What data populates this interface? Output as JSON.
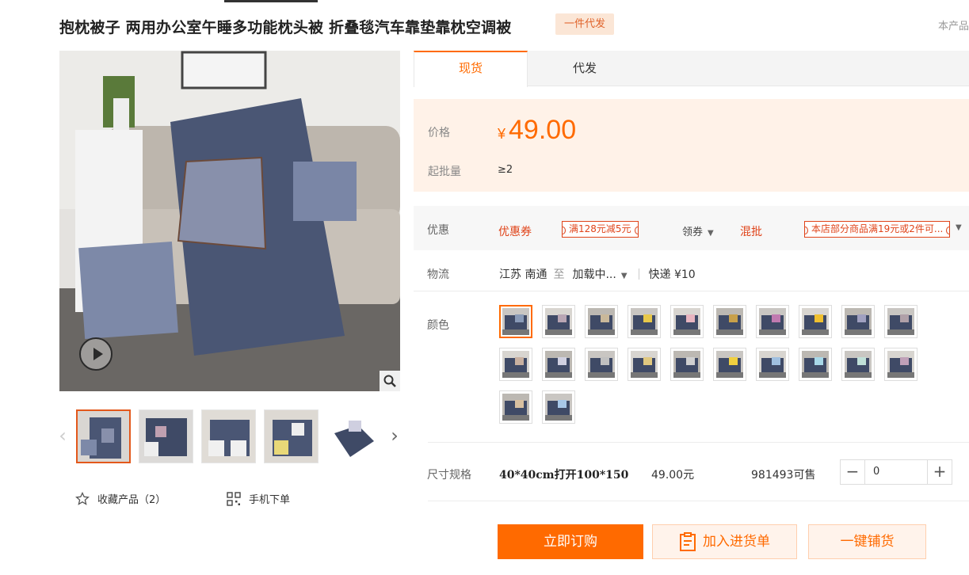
{
  "product": {
    "title": "抱枕被子 两用办公室午睡多功能枕头被 折叠毯汽车靠垫靠枕空调被",
    "tag": "一件代发",
    "corner_text": "本产品"
  },
  "gallery": {
    "thumb_count": 5,
    "favorite_label": "收藏产品（2）",
    "mobile_order_label": "手机下单",
    "play_icon": "play-icon",
    "zoom_icon": "zoom-icon"
  },
  "tabs": [
    {
      "label": "现货",
      "active": true
    },
    {
      "label": "代发",
      "active": false
    }
  ],
  "price": {
    "label": "价格",
    "currency": "¥",
    "value": "49.00",
    "moq_label": "起批量",
    "moq_value": "≥2"
  },
  "promo": {
    "label": "优惠",
    "coupon_title": "优惠券",
    "coupon_tag": "满128元减5元",
    "get_coupon": "领券",
    "mix_title": "混批",
    "mix_tag": "本店部分商品满19元或2件可..."
  },
  "logistics": {
    "label": "物流",
    "from": "江苏 南通",
    "to_word": "至",
    "dest": "加载中...",
    "express": "快递 ¥10"
  },
  "colors": {
    "label": "颜色",
    "count": 22,
    "selected_index": 0,
    "accents": [
      "#8a9bb8",
      "#b9a6b4",
      "#c9b89a",
      "#e8c84a",
      "#e8b5c0",
      "#c8a04a",
      "#c07ab0",
      "#f0c030",
      "#a0a0c0",
      "#b0a0a8",
      "#c8b0a0",
      "#d0d0e0",
      "#c0c0c0",
      "#e0c880",
      "#d0d0d0",
      "#f0d040",
      "#a0c0e0",
      "#a8d8e8",
      "#c0e0d8",
      "#c0a0b8",
      "#d8c0a0",
      "#a8c8e8"
    ],
    "accent_color": "#ff6a00"
  },
  "sku": {
    "label": "尺寸规格",
    "name": "40*40cm打开100*150",
    "price": "49.00元",
    "stock": "981493可售",
    "quantity": "0",
    "minus": "−",
    "plus": "+"
  },
  "actions": {
    "buy": "立即订购",
    "cart": "加入进货单",
    "one_key": "一键铺货"
  }
}
